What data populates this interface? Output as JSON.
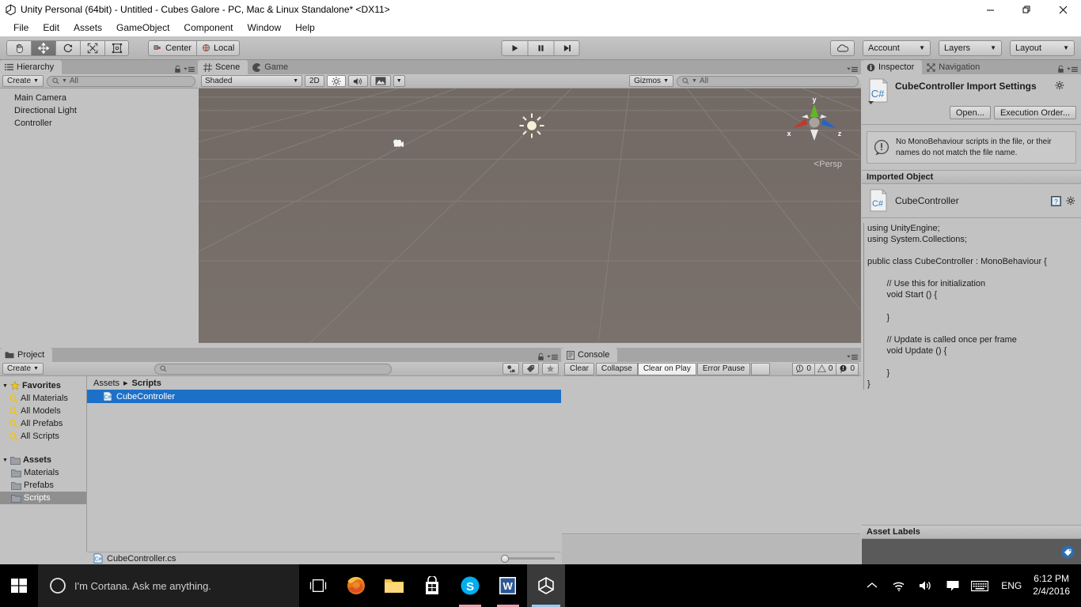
{
  "window": {
    "title": "Unity Personal (64bit) - Untitled - Cubes Galore - PC, Mac & Linux Standalone* <DX11>",
    "app_icon": "unity-icon",
    "minimize": "—",
    "restore": "❐",
    "close": "✕"
  },
  "menubar": {
    "items": [
      {
        "label": "File"
      },
      {
        "label": "Edit"
      },
      {
        "label": "Assets"
      },
      {
        "label": "GameObject"
      },
      {
        "label": "Component"
      },
      {
        "label": "Window"
      },
      {
        "label": "Help"
      }
    ]
  },
  "toolbar": {
    "transform_tools": [
      {
        "name": "hand-tool",
        "icon": "hand-icon",
        "active": false
      },
      {
        "name": "move-tool",
        "icon": "move-icon",
        "active": true
      },
      {
        "name": "rotate-tool",
        "icon": "rotate-icon",
        "active": false
      },
      {
        "name": "scale-tool",
        "icon": "scale-icon",
        "active": false
      },
      {
        "name": "rect-tool",
        "icon": "rect-icon",
        "active": false
      }
    ],
    "pivot_mode": "Center",
    "pivot_rotation": "Local",
    "play": "play-icon",
    "pause": "pause-icon",
    "step": "step-icon",
    "cloud": "cloud-icon",
    "account": "Account",
    "layers": "Layers",
    "layout": "Layout"
  },
  "hierarchy": {
    "tab": "Hierarchy",
    "tab_icon": "hierarchy-icon",
    "create_label": "Create",
    "search_placeholder": "All",
    "items": [
      {
        "label": "Main Camera"
      },
      {
        "label": "Directional Light"
      },
      {
        "label": "Controller"
      }
    ]
  },
  "scene": {
    "tabs": [
      {
        "label": "Scene",
        "icon": "scene-icon",
        "selected": true
      },
      {
        "label": "Game",
        "icon": "game-icon",
        "selected": false
      }
    ],
    "draw_mode": "Shaded",
    "mode_2d": "2D",
    "lighting_icon": "lighting-icon",
    "audio_icon": "audio-icon",
    "effects_icon": "image-icon",
    "gizmos_label": "Gizmos",
    "search_placeholder": "All",
    "axis_labels": {
      "x": "x",
      "y": "y",
      "z": "z"
    },
    "projection": "Persp",
    "axis_colors": {
      "x": "#c0392b",
      "y": "#62b62a",
      "z": "#2563c8",
      "neutral": "#e8e8e8"
    },
    "background": "#736a66"
  },
  "inspector": {
    "tabs": [
      {
        "label": "Inspector",
        "icon": "info-icon",
        "selected": true
      },
      {
        "label": "Navigation",
        "icon": "navigation-icon",
        "selected": false
      }
    ],
    "title": "CubeController Import Settings",
    "icon": "csharp-script-icon",
    "open_button": "Open...",
    "execution_order_button": "Execution Order...",
    "warning": "No MonoBehaviour scripts in the file, or their names do not match the file name.",
    "warning_icon": "warning-icon",
    "imported_object_header": "Imported Object",
    "imported_object_name": "CubeController",
    "help_icon": "help-icon",
    "gear_icon": "gear-icon",
    "code": "using UnityEngine;\nusing System.Collections;\n\npublic class CubeController : MonoBehaviour {\n\n        // Use this for initialization\n        void Start () {\n\n        }\n\n        // Update is called once per frame\n        void Update () {\n\n        }\n}",
    "asset_labels_header": "Asset Labels",
    "asset_label_icon": "label-icon"
  },
  "project": {
    "tab": "Project",
    "tab_icon": "folder-icon",
    "create_label": "Create",
    "search_placeholder": "",
    "filter_icons": [
      "object-filter-icon",
      "label-filter-icon",
      "favorite-filter-icon"
    ],
    "favorites_header": "Favorites",
    "favorites": [
      {
        "label": "All Materials",
        "icon": "search-icon"
      },
      {
        "label": "All Models",
        "icon": "search-icon"
      },
      {
        "label": "All Prefabs",
        "icon": "search-icon"
      },
      {
        "label": "All Scripts",
        "icon": "search-icon"
      }
    ],
    "assets_header": "Assets",
    "folders": [
      {
        "label": "Materials",
        "selected": false
      },
      {
        "label": "Prefabs",
        "selected": false
      },
      {
        "label": "Scripts",
        "selected": true
      }
    ],
    "breadcrumb": [
      {
        "label": "Assets",
        "current": false
      },
      {
        "label": "Scripts",
        "current": true
      }
    ],
    "breadcrumb_separator": "▸",
    "assets": [
      {
        "label": "CubeController",
        "icon": "csharp-script-icon",
        "selected": true
      }
    ],
    "status_file": "CubeController.cs",
    "status_icon": "csharp-script-icon"
  },
  "console": {
    "tab": "Console",
    "tab_icon": "console-icon",
    "clear": "Clear",
    "collapse": "Collapse",
    "clear_on_play": "Clear on Play",
    "error_pause": "Error Pause",
    "counters": [
      {
        "icon": "log-icon",
        "count": "0"
      },
      {
        "icon": "warn-icon",
        "count": "0"
      },
      {
        "icon": "error-icon",
        "count": "0"
      }
    ]
  },
  "taskbar": {
    "start_icon": "windows-icon",
    "cortana_icon": "cortana-circle-icon",
    "cortana_placeholder": "I'm Cortana. Ask me anything.",
    "apps": [
      {
        "name": "task-view",
        "icon": "task-view-icon",
        "open": false,
        "active": false
      },
      {
        "name": "firefox",
        "icon": "firefox-icon",
        "open": false,
        "active": false
      },
      {
        "name": "file-explorer",
        "icon": "folder-icon",
        "open": false,
        "active": false
      },
      {
        "name": "microsoft-store",
        "icon": "store-icon",
        "open": false,
        "active": false
      },
      {
        "name": "skype",
        "icon": "skype-icon",
        "open": true,
        "active": false
      },
      {
        "name": "word",
        "icon": "word-icon",
        "open": true,
        "active": false
      },
      {
        "name": "unity",
        "icon": "unity-icon",
        "open": true,
        "active": true
      }
    ],
    "tray": {
      "chevron": "⌃",
      "network_icon": "wifi-icon",
      "volume_icon": "volume-icon",
      "action_center_icon": "notification-icon",
      "keyboard_icon": "keyboard-icon",
      "language": "ENG",
      "time": "6:12 PM",
      "date": "2/4/2016"
    }
  }
}
